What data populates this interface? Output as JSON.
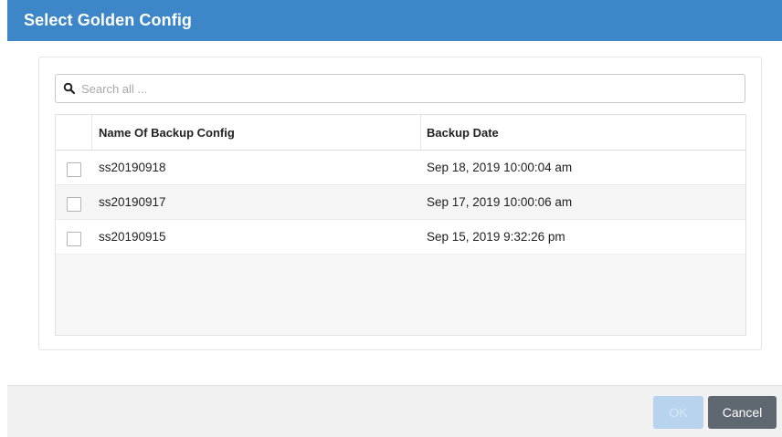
{
  "dialog": {
    "title": "Select Golden Config"
  },
  "search": {
    "placeholder": "Search all ...",
    "value": "",
    "icon": "search-icon"
  },
  "table": {
    "columns": [
      "Name Of Backup Config",
      "Backup Date"
    ],
    "rows": [
      {
        "name": "ss20190918",
        "date": "Sep 18, 2019 10:00:04 am",
        "checked": false
      },
      {
        "name": "ss20190917",
        "date": "Sep 17, 2019 10:00:06 am",
        "checked": false
      },
      {
        "name": "ss20190915",
        "date": "Sep 15, 2019 9:32:26 pm",
        "checked": false
      }
    ]
  },
  "footer": {
    "ok_label": "OK",
    "cancel_label": "Cancel"
  },
  "colors": {
    "title_bar": "#3d87c9",
    "ok_button_disabled": "#b7d3ee",
    "cancel_button": "#5f6770"
  }
}
